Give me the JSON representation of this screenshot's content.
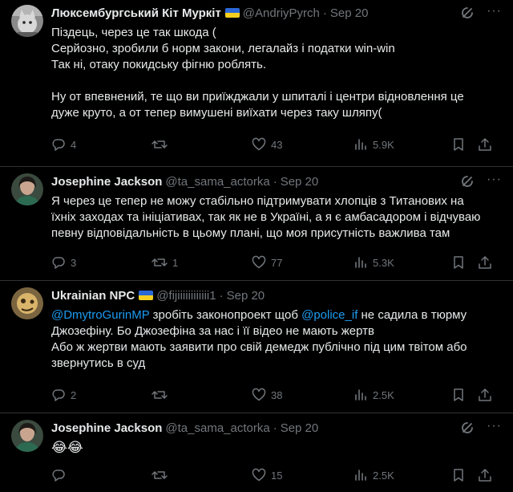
{
  "tweets": [
    {
      "name": "Люксембургський Кіт Муркіт",
      "verified_flag": true,
      "handle": "@AndriyPyrch",
      "date": "Sep 20",
      "lines": [
        "Піздець, через це так шкода (",
        "Серйозно, зробили б норм закони, легалайз і податки win-win",
        "Так ні, отаку покидську фігню роблять.",
        "",
        "Ну от впевнений, те що ви приїжджали у шпиталі і центри відновлення це",
        "дуже круто, а от тепер вимушені виїхати через таку шляпу("
      ],
      "replies": "4",
      "reposts": "",
      "likes": "43",
      "views": "5.9K"
    },
    {
      "name": "Josephine Jackson",
      "handle": "@ta_sama_actorka",
      "date": "Sep 20",
      "lines": [
        "Я через це тепер не можу стабільно підтримувати хлопців з Титанових на",
        "їхніх заходах та ініціативах, так як не в Україні, а я є амбасадором і відчуваю",
        "певну відповідальність в цьому плані, що моя присутність важлива там"
      ],
      "replies": "3",
      "reposts": "1",
      "likes": "77",
      "views": "5.3K"
    },
    {
      "name": "Ukrainian NPC",
      "verified_flag": true,
      "handle": "@fijiiiiiiiiiiii1",
      "date": "Sep 20",
      "line1_mention1": "@DmytroGurinMP",
      "line1_text1": " зробіть законопроект щоб ",
      "line1_mention2": "@police_if",
      "line1_text2": " не садила в тюрму",
      "lines": [
        "Джозефіну. Бо Джозефіна за нас і її відео не мають жертв",
        "Або ж жертви мають заявити про свій демедж публічно під цим твітом  або",
        "звернутись в суд"
      ],
      "replies": "2",
      "reposts": "",
      "likes": "38",
      "views": "2.5K"
    },
    {
      "name": "Josephine Jackson",
      "handle": "@ta_sama_actorka",
      "date": "Sep 20",
      "emoji": "😂😂",
      "replies": "",
      "reposts": "",
      "likes": "15",
      "views": "2.5K"
    }
  ],
  "separator_dot": "·",
  "more_glyph": "···",
  "colors": {
    "background": "#000000",
    "text": "#e7e9ea",
    "muted": "#71767b",
    "link": "#1d9bf0",
    "divider": "#2f3336",
    "flag_blue": "#2a68d6",
    "flag_yellow": "#f5cf1f"
  },
  "icons": [
    "reply-icon",
    "repost-icon",
    "like-icon",
    "views-icon",
    "bookmark-icon",
    "share-icon",
    "grok-icon",
    "more-icon",
    "ukraine-flag-icon"
  ]
}
